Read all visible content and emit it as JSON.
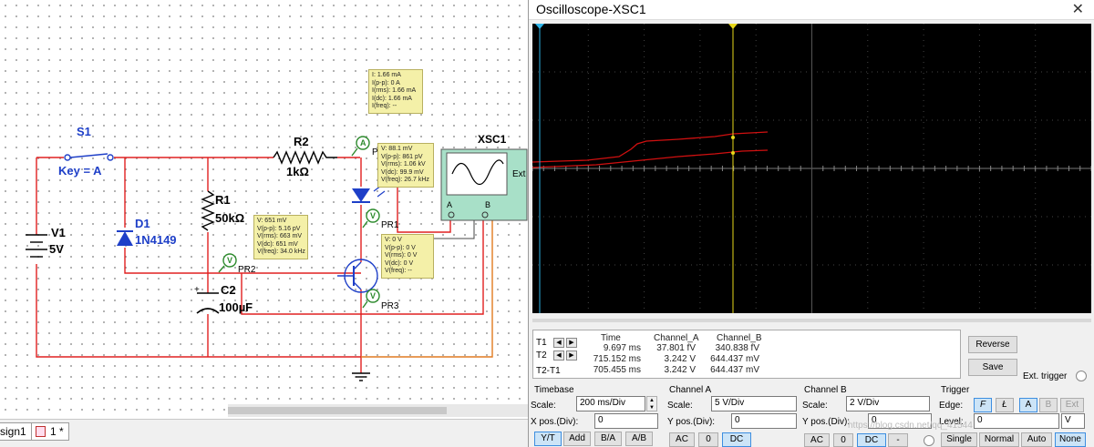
{
  "schematic": {
    "components": {
      "s1": "S1",
      "key": "Key = A",
      "v1": "V1",
      "v1_val": "5V",
      "d1": "D1",
      "d1_val": "1N4149",
      "r1": "R1",
      "r1_val": "50kΩ",
      "r2": "R2",
      "r2_val": "1kΩ",
      "c2": "C2",
      "c2_val": "100µF",
      "xsc1": "XSC1",
      "xsc_ext": "Ext",
      "xsc_a": "A",
      "xsc_b": "B",
      "pr1": "PR1",
      "pr2": "PR2",
      "pr3": "PR3",
      "pr_partial": "PR"
    },
    "probe_current": [
      "I: 1.66 mA",
      "I(p-p): 0 A",
      "I(rms): 1.66 mA",
      "I(dc): 1.66 mA",
      "I(freq): --"
    ],
    "probe_pr1": [
      "V: 88.1 mV",
      "V(p-p): 861 pV",
      "V(rms): 1.06 kV",
      "V(dc): 99.9 mV",
      "V(freq): 26.7 kHz"
    ],
    "probe_pr2": [
      "V: 651 mV",
      "V(p-p): 5.16 pV",
      "V(rms): 663 mV",
      "V(dc): 651 mV",
      "V(freq): 34.0 kHz"
    ],
    "probe_pr3": [
      "V: 0 V",
      "V(p-p): 0 V",
      "V(rms): 0 V",
      "V(dc): 0 V",
      "V(freq): --"
    ]
  },
  "tabs": {
    "tab1": "sign1",
    "tab2": "1 *"
  },
  "oscilloscope": {
    "title": "Oscilloscope-XSC1",
    "close": "✕",
    "cursor_table": {
      "headers": [
        "Time",
        "Channel_A",
        "Channel_B"
      ],
      "rows": [
        {
          "label": "T1",
          "time": "9.697 ms",
          "a": "37.801 fV",
          "b": "340.838 fV"
        },
        {
          "label": "T2",
          "time": "715.152 ms",
          "a": "3.242 V",
          "b": "644.437 mV"
        },
        {
          "label": "T2-T1",
          "time": "705.455 ms",
          "a": "3.242 V",
          "b": "644.437 mV"
        }
      ]
    },
    "buttons": {
      "reverse": "Reverse",
      "save": "Save",
      "ext_trigger": "Ext. trigger"
    },
    "timebase": {
      "title": "Timebase",
      "scale_label": "Scale:",
      "scale": "200 ms/Div",
      "xpos_label": "X pos.(Div):",
      "xpos": "0",
      "modes": [
        "Y/T",
        "Add",
        "B/A",
        "A/B"
      ]
    },
    "channel_a": {
      "title": "Channel A",
      "scale_label": "Scale:",
      "scale": "5  V/Div",
      "ypos_label": "Y pos.(Div):",
      "ypos": "0",
      "coupling": [
        "AC",
        "0",
        "DC"
      ]
    },
    "channel_b": {
      "title": "Channel B",
      "scale_label": "Scale:",
      "scale": "2  V/Div",
      "ypos_label": "Y pos.(Div):",
      "ypos": "0",
      "coupling": [
        "AC",
        "0",
        "DC",
        "-"
      ]
    },
    "trigger": {
      "title": "Trigger",
      "edge_label": "Edge:",
      "edge": [
        "F",
        "Ł",
        "A",
        "B",
        "Ext"
      ],
      "level_label": "Level:",
      "level": "0",
      "level_unit": "V",
      "modes": [
        "Single",
        "Normal",
        "Auto",
        "None"
      ]
    }
  },
  "watermark": "https://blog.csdn.net/qq_41544"
}
